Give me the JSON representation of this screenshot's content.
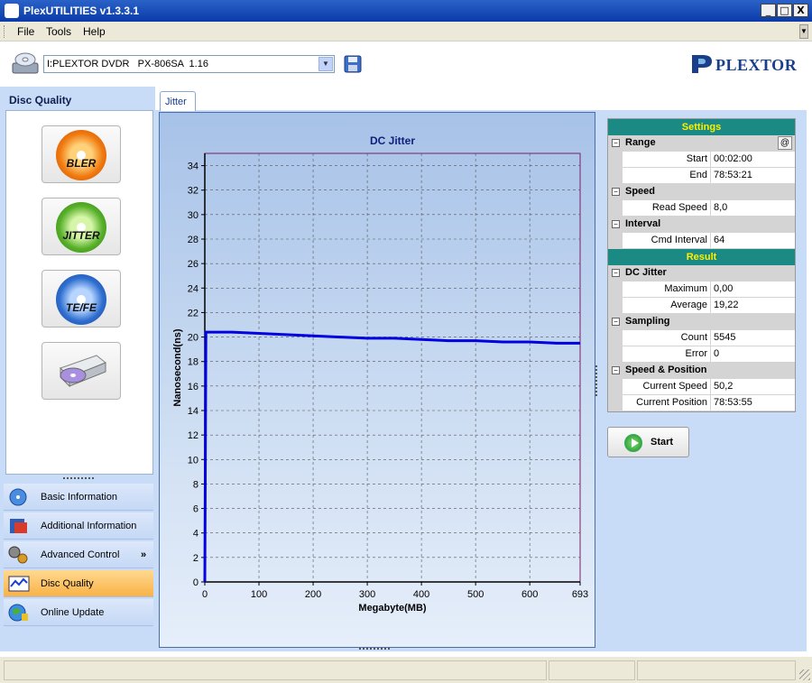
{
  "window": {
    "title": "PlexUTILITIES v1.3.3.1",
    "minimize": "_",
    "maximize": "□",
    "close": "X"
  },
  "menu": {
    "items": [
      "File",
      "Tools",
      "Help"
    ]
  },
  "drive": {
    "selected": "I:PLEXTOR DVDR   PX-806SA  1.16"
  },
  "logo": {
    "text": "PLEXTOR"
  },
  "sidebar": {
    "header": "Disc Quality",
    "tools": [
      {
        "label": "BLER",
        "color": "#f07a10"
      },
      {
        "label": "JITTER",
        "color": "#58b02a"
      },
      {
        "label": "TE/FE",
        "color": "#2f6fd0"
      },
      {
        "label": "",
        "color": ""
      }
    ],
    "nav": [
      {
        "label": "Basic Information"
      },
      {
        "label": "Additional Information"
      },
      {
        "label": "Advanced Control"
      },
      {
        "label": "Disc Quality",
        "active": true
      },
      {
        "label": "Online Update"
      }
    ],
    "more": "»"
  },
  "tabs": [
    {
      "label": "Jitter"
    }
  ],
  "chart_data": {
    "type": "line",
    "title": "DC Jitter",
    "xlabel": "Megabyte(MB)",
    "ylabel": "Nanosecond(ns)",
    "xlim": [
      0,
      693
    ],
    "ylim": [
      0,
      35
    ],
    "xticks": [
      0,
      100,
      200,
      300,
      400,
      500,
      600,
      693
    ],
    "yticks": [
      0,
      2,
      4,
      6,
      8,
      10,
      12,
      14,
      16,
      18,
      20,
      22,
      24,
      26,
      28,
      30,
      32,
      34
    ],
    "grid": true,
    "series": [
      {
        "color": "#0000e0",
        "x": [
          0,
          2,
          50,
          100,
          150,
          200,
          250,
          300,
          350,
          400,
          450,
          500,
          550,
          600,
          650,
          693
        ],
        "y": [
          0,
          20.4,
          20.4,
          20.3,
          20.2,
          20.1,
          20.0,
          19.9,
          19.9,
          19.8,
          19.7,
          19.7,
          19.6,
          19.6,
          19.5,
          19.5
        ]
      }
    ]
  },
  "settings": {
    "header": "Settings",
    "range": {
      "label": "Range",
      "at": "@",
      "start_label": "Start",
      "start": "00:02:00",
      "end_label": "End",
      "end": "78:53:21"
    },
    "speed": {
      "label": "Speed",
      "read_label": "Read Speed",
      "read": "8,0"
    },
    "interval": {
      "label": "Interval",
      "cmd_label": "Cmd Interval",
      "cmd": "64"
    }
  },
  "result": {
    "header": "Result",
    "dcjitter": {
      "label": "DC Jitter",
      "max_label": "Maximum",
      "max": "0,00",
      "avg_label": "Average",
      "avg": "19,22"
    },
    "sampling": {
      "label": "Sampling",
      "count_label": "Count",
      "count": "5545",
      "error_label": "Error",
      "error": "0"
    },
    "speedpos": {
      "label": "Speed & Position",
      "speed_label": "Current Speed",
      "speed": "50,2",
      "pos_label": "Current Position",
      "pos": "78:53:55"
    }
  },
  "start_button": {
    "label": "Start"
  }
}
